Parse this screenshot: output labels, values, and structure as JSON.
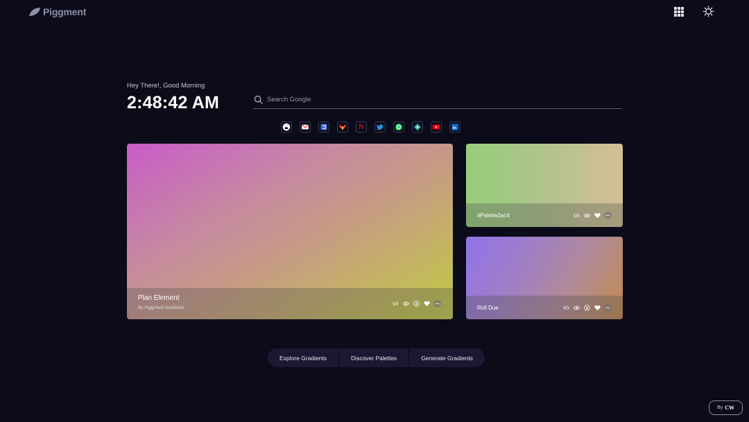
{
  "brand": {
    "name": "Piggment"
  },
  "header": {
    "apps_icon": "grid-icon",
    "theme_icon": "sun-icon"
  },
  "greeting": {
    "text": "Hey There!, Good Morning",
    "time": "2:48:42 AM"
  },
  "search": {
    "placeholder": "Search Google"
  },
  "shortcuts": [
    {
      "name": "github",
      "glyph": "",
      "color": "#ffffff"
    },
    {
      "name": "gmail",
      "glyph": "",
      "color": "#ea4335"
    },
    {
      "name": "blue-app",
      "glyph": "",
      "color": "#3b67d8"
    },
    {
      "name": "gitlab",
      "glyph": "",
      "color": "#e2432a"
    },
    {
      "name": "netflix",
      "glyph": "N",
      "color": "#e50914"
    },
    {
      "name": "twitter",
      "glyph": "",
      "color": "#1d9bf0"
    },
    {
      "name": "whatsapp",
      "glyph": "",
      "color": "#25d366"
    },
    {
      "name": "teal-app",
      "glyph": "",
      "color": "#2aa39a"
    },
    {
      "name": "youtube",
      "glyph": "",
      "color": "#ff0000"
    },
    {
      "name": "linkedin",
      "glyph": "in",
      "color": "#0a66c2"
    }
  ],
  "cards": {
    "main": {
      "title": "Plan Element",
      "subtitle": "By Piggment Gradients"
    },
    "top_right": {
      "title": "#Palette2ac4"
    },
    "bottom_right": {
      "title": "Roll Due"
    }
  },
  "bottom_nav": {
    "explore": "Explore Gradients",
    "discover": "Discover Palettes",
    "generate": "Generate Gradients"
  },
  "credit": {
    "prefix": "By",
    "initials": "CW"
  }
}
